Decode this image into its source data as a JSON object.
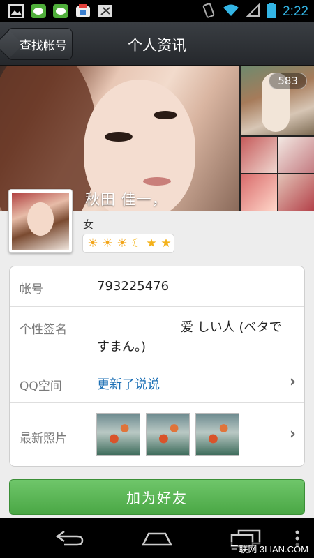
{
  "status_bar": {
    "time": "2:22",
    "left_icons": [
      "image-icon",
      "chat-icon",
      "chat-icon",
      "store-icon",
      "debug-icon"
    ],
    "right_icons": [
      "vibrate-icon",
      "wifi-icon",
      "signal-icon",
      "battery-icon"
    ]
  },
  "header": {
    "back_label": "查找帐号",
    "title": "个人资讯"
  },
  "photos": {
    "count": "583"
  },
  "profile": {
    "name": "秋田 佳一，",
    "gender": "女",
    "level_icons": [
      "sun",
      "sun",
      "sun",
      "moon",
      "star",
      "star"
    ]
  },
  "info": {
    "account_label": "帐号",
    "account_value": "793225476",
    "signature_label": "个性签名",
    "signature_value": "爱 しい人 (ベタですまん。)",
    "qzone_label": "QQ空间",
    "qzone_value": "更新了说说",
    "photos_label": "最新照片"
  },
  "actions": {
    "add_friend": "加为好友"
  },
  "watermark": "三联网 3LIAN.COM",
  "colors": {
    "accent_blue": "#33b5e5",
    "link_blue": "#1b6fb5",
    "button_green": "#5bb656"
  }
}
